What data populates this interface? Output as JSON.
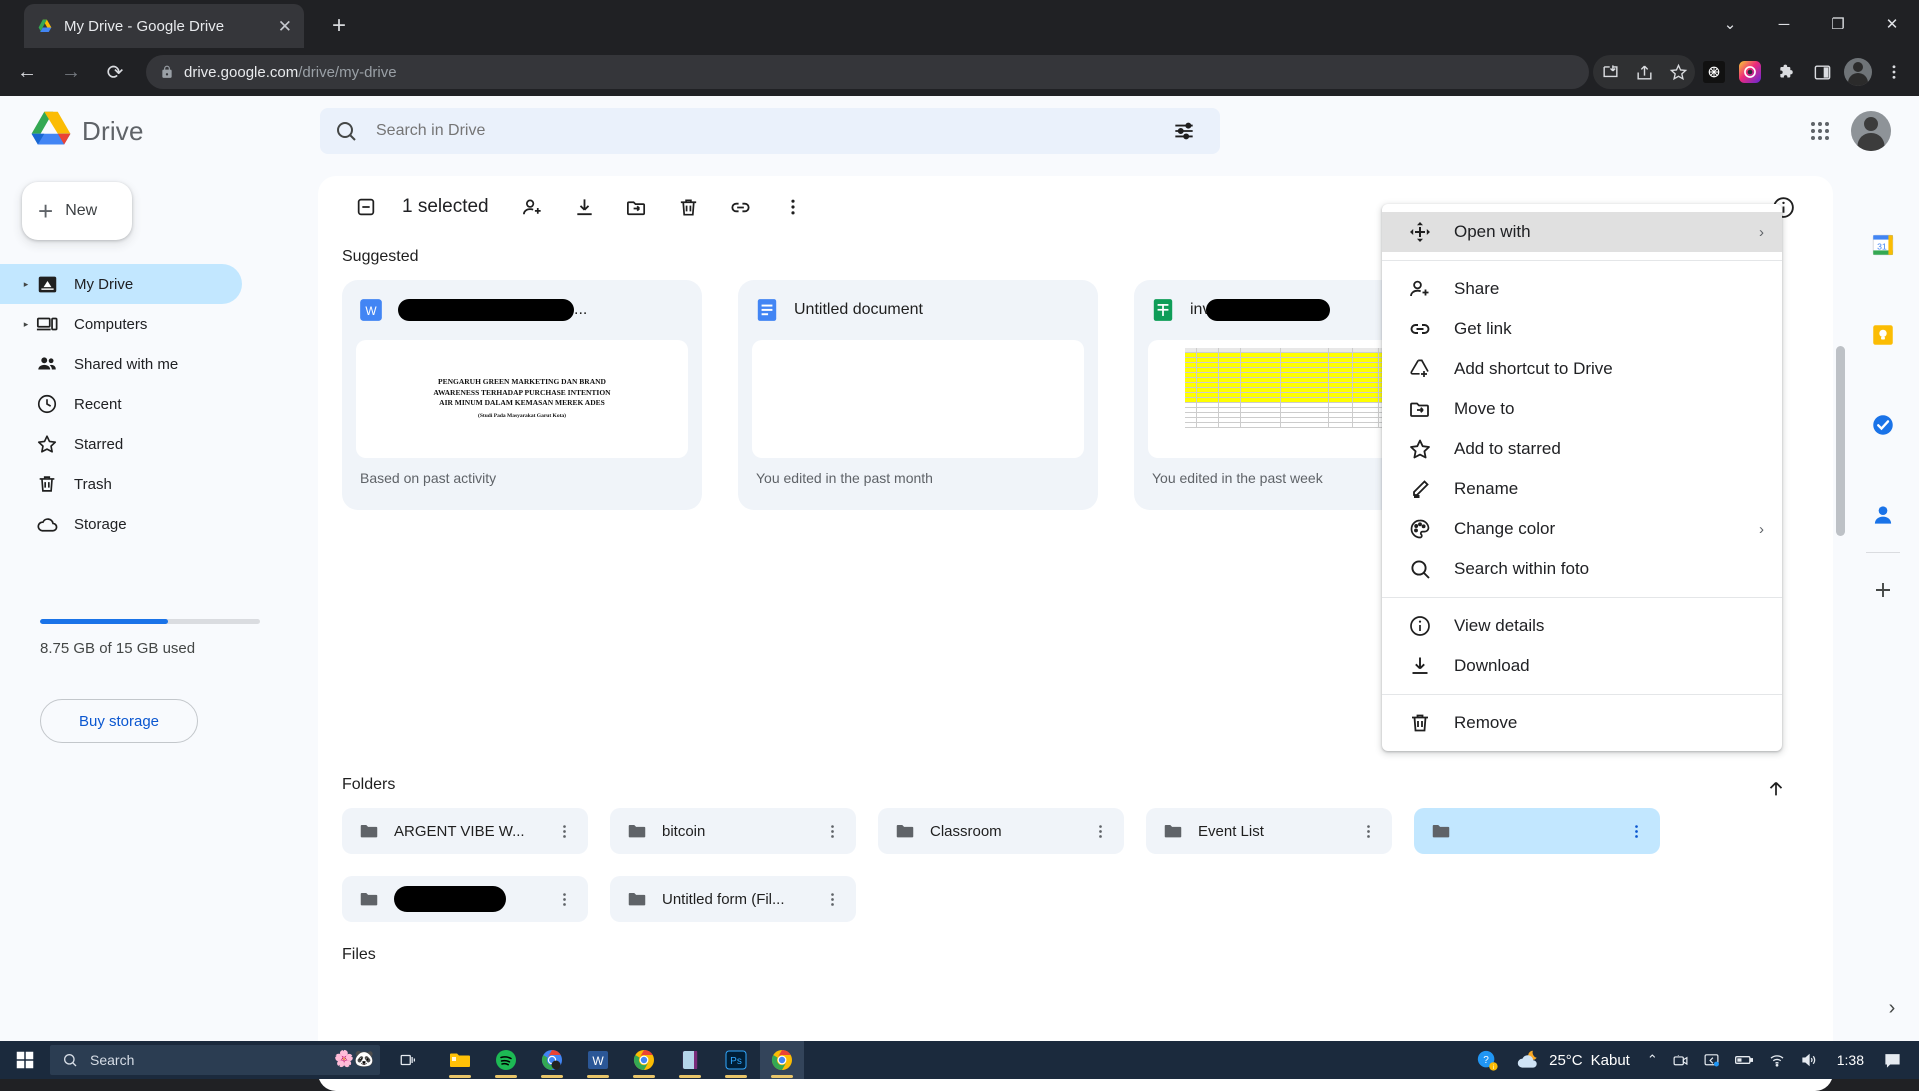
{
  "browser": {
    "tab": {
      "title": "My Drive - Google Drive",
      "favicon": "drive-favicon",
      "close_label": "✕"
    },
    "new_tab_label": "+",
    "window_controls": {
      "minimize": "─",
      "maximize": "❐",
      "close": "✕",
      "chevron": "⌄"
    },
    "nav": {
      "back": "←",
      "forward": "→",
      "reload": "⟳"
    },
    "url": {
      "domain": "drive.google.com",
      "path": "/drive/my-drive"
    },
    "toolbar_icons": [
      "install-icon",
      "share-icon",
      "bookmark-star-icon",
      "extension-dark-icon",
      "colorful-circle-icon",
      "puzzle-extensions-icon",
      "side-panel-icon",
      "profile-avatar-icon",
      "chrome-menu-icon"
    ]
  },
  "drive": {
    "logo_name": "drive-logo",
    "app_name": "Drive",
    "search": {
      "placeholder": "Search in Drive",
      "value": "",
      "icon": "search-icon",
      "tune_icon": "tune-icon"
    },
    "header_right": {
      "apps_icon": "google-apps-grid-icon",
      "avatar": "account-avatar"
    },
    "new_button": {
      "label": "New",
      "icon": "plus-icon"
    },
    "nav_items": [
      {
        "label": "My Drive",
        "icon": "my-drive-icon",
        "caret": true,
        "active": true
      },
      {
        "label": "Computers",
        "icon": "computers-icon",
        "caret": true,
        "active": false
      },
      {
        "label": "Shared with me",
        "icon": "shared-icon",
        "caret": false,
        "active": false
      },
      {
        "label": "Recent",
        "icon": "clock-icon",
        "caret": false,
        "active": false
      },
      {
        "label": "Starred",
        "icon": "star-icon",
        "caret": false,
        "active": false
      },
      {
        "label": "Trash",
        "icon": "trash-icon",
        "caret": false,
        "active": false
      },
      {
        "label": "Storage",
        "icon": "cloud-icon",
        "caret": false,
        "active": false
      }
    ],
    "storage": {
      "text": "8.75 GB of 15 GB used",
      "percent": 58,
      "buy_label": "Buy storage",
      "bar_color": "#1a73e8"
    },
    "toolbar": {
      "selection_checkbox_icon": "indeterminate-checkbox-icon",
      "selected_text": "1 selected",
      "actions": [
        {
          "icon": "person-add-icon",
          "name": "share-button"
        },
        {
          "icon": "download-icon",
          "name": "download-button"
        },
        {
          "icon": "move-to-icon",
          "name": "move-to-button"
        },
        {
          "icon": "trash-icon",
          "name": "remove-button"
        },
        {
          "icon": "link-icon",
          "name": "get-link-button"
        },
        {
          "icon": "more-vert-icon",
          "name": "more-actions-button"
        }
      ],
      "info_icon": "info-icon"
    },
    "sections": {
      "suggested": "Suggested",
      "folders": "Folders",
      "files": "Files"
    },
    "suggested": [
      {
        "title": "",
        "title_redacted": true,
        "title_suffix": "...",
        "icon": "word-doc-icon",
        "icon_color": "#4285f4",
        "subtitle": "Based on past activity",
        "thumb_type": "document",
        "thumb_lines": [
          "PENGARUH GREEN MARKETING DAN BRAND",
          "AWARENESS TERHADAP PURCHASE INTENTION",
          "AIR MINUM DALAM KEMASAN MEREK ADES"
        ],
        "thumb_sub": "(Studi Pada Masyarakat Garut Kota)"
      },
      {
        "title": "Untitled document",
        "title_redacted": false,
        "title_suffix": "",
        "icon": "google-docs-icon",
        "icon_color": "#4285f4",
        "subtitle": "You edited in the past month",
        "thumb_type": "blank",
        "thumb_lines": [],
        "thumb_sub": ""
      },
      {
        "title": "inv",
        "title_redacted": true,
        "title_suffix": "",
        "icon": "google-sheets-icon",
        "icon_color": "#0f9d58",
        "subtitle": "You edited in the past week",
        "thumb_type": "spreadsheet",
        "thumb_lines": [],
        "thumb_sub": ""
      }
    ],
    "folders": [
      {
        "name": "ARGENT VIBE W...",
        "redacted": false,
        "selected": false
      },
      {
        "name": "bitcoin",
        "redacted": false,
        "selected": false
      },
      {
        "name": "Classroom",
        "redacted": false,
        "selected": false
      },
      {
        "name": "Event List",
        "redacted": false,
        "selected": false
      },
      {
        "name": "",
        "redacted": false,
        "selected": true
      },
      {
        "name": "",
        "redacted": true,
        "selected": false
      },
      {
        "name": "Untitled form (Fil...",
        "redacted": false,
        "selected": false
      }
    ],
    "folder_kebab_icon": "more-vert-icon",
    "sort_arrow_icon": "arrow-up-icon",
    "side_panel": [
      {
        "icon": "google-calendar-icon",
        "name": "sidepanel-calendar"
      },
      {
        "icon": "google-keep-icon",
        "name": "sidepanel-keep"
      },
      {
        "icon": "google-tasks-icon",
        "name": "sidepanel-tasks"
      },
      {
        "icon": "google-contacts-icon",
        "name": "sidepanel-contacts"
      }
    ],
    "side_panel_add": {
      "icon": "plus-icon",
      "name": "sidepanel-add-button"
    },
    "bottom_chevron": "›"
  },
  "context_menu": {
    "items": [
      {
        "label": "Open with",
        "icon": "open-with-icon",
        "submenu": true,
        "highlight": true,
        "sep_after": true
      },
      {
        "label": "Share",
        "icon": "person-add-icon",
        "submenu": false,
        "highlight": false,
        "sep_after": false
      },
      {
        "label": "Get link",
        "icon": "link-icon",
        "submenu": false,
        "highlight": false,
        "sep_after": false
      },
      {
        "label": "Add shortcut to Drive",
        "icon": "add-shortcut-icon",
        "submenu": false,
        "highlight": false,
        "sep_after": false
      },
      {
        "label": "Move to",
        "icon": "move-to-icon",
        "submenu": false,
        "highlight": false,
        "sep_after": false
      },
      {
        "label": "Add to starred",
        "icon": "star-icon",
        "submenu": false,
        "highlight": false,
        "sep_after": false
      },
      {
        "label": "Rename",
        "icon": "pencil-icon",
        "submenu": false,
        "highlight": false,
        "sep_after": false
      },
      {
        "label": "Change color",
        "icon": "palette-icon",
        "submenu": true,
        "highlight": false,
        "sep_after": false
      },
      {
        "label": "Search within foto",
        "icon": "search-icon",
        "submenu": false,
        "highlight": false,
        "sep_after": true
      },
      {
        "label": "View details",
        "icon": "info-icon",
        "submenu": false,
        "highlight": false,
        "sep_after": false
      },
      {
        "label": "Download",
        "icon": "download-icon",
        "submenu": false,
        "highlight": false,
        "sep_after": true
      },
      {
        "label": "Remove",
        "icon": "trash-icon",
        "submenu": false,
        "highlight": false,
        "sep_after": false
      }
    ],
    "submenu_arrow": "›"
  },
  "taskbar": {
    "start_icon": "windows-start-icon",
    "search": {
      "placeholder": "Search",
      "icon": "search-icon"
    },
    "widget_icon": "weather-widget-icon",
    "task_view_icon": "task-view-icon",
    "apps": [
      {
        "icon": "file-explorer-icon",
        "name": "taskbar-file-explorer",
        "active": false,
        "running": true
      },
      {
        "icon": "spotify-icon",
        "name": "taskbar-spotify",
        "active": false,
        "running": true
      },
      {
        "icon": "chrome-beta-icon",
        "name": "taskbar-chrome-beta",
        "active": false,
        "running": true
      },
      {
        "icon": "word-icon",
        "name": "taskbar-word",
        "active": false,
        "running": true
      },
      {
        "icon": "chrome-icon",
        "name": "taskbar-chrome",
        "active": false,
        "running": true
      },
      {
        "icon": "onenote-icon",
        "name": "taskbar-onenote",
        "active": false,
        "running": true
      },
      {
        "icon": "photoshop-icon",
        "name": "taskbar-photoshop",
        "active": false,
        "running": true
      },
      {
        "icon": "chrome-icon",
        "name": "taskbar-chrome-active",
        "active": true,
        "running": true
      }
    ],
    "tray": {
      "help_icon": "help-badge-icon",
      "weather": {
        "temp": "25°C",
        "condition": "Kabut",
        "icon": "cloud-moon-icon"
      },
      "chevron": "⌃",
      "icons": [
        "camera-icon",
        "display-icon",
        "battery-icon",
        "wifi-icon",
        "volume-icon"
      ],
      "clock": "1:38",
      "notification_icon": "notification-icon"
    }
  }
}
